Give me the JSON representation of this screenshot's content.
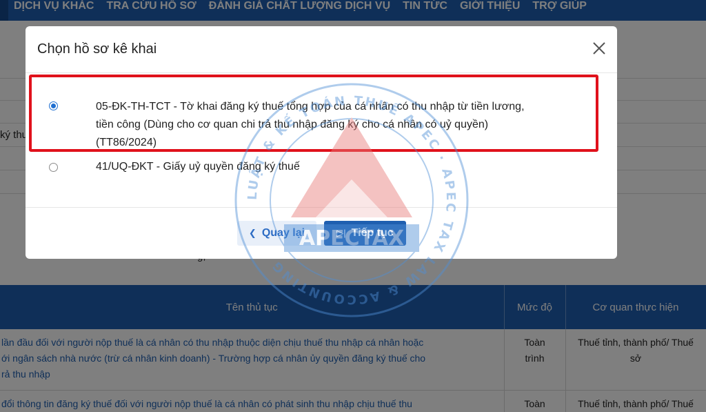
{
  "topnav": {
    "items": [
      "DỊCH VỤ KHÁC",
      "TRA CỨU HỒ SƠ",
      "ĐÁNH GIÁ CHẤT LƯỢNG DỊCH VỤ",
      "TIN TỨC",
      "GIỚI THIỆU",
      "TRỢ GIÚP"
    ]
  },
  "background": {
    "left_fragment": "ký thu",
    "mid_fragment": "g,"
  },
  "table": {
    "headers": [
      "Tên thủ tục",
      "Mức độ",
      "Cơ quan thực hiện"
    ],
    "rows": [
      {
        "name_lines": [
          "lần đầu đối với người nộp thuế là cá nhân có thu nhập thuộc diện chịu thuế thu nhập cá nhân hoặc",
          "ới ngân sách nhà nước (trừ cá nhân kinh doanh) - Trường hợp cá nhân ủy quyền đăng ký thuế cho",
          "rả thu nhập"
        ],
        "level_lines": [
          "Toàn",
          "trình"
        ],
        "agency_lines": [
          "Thuế tỉnh, thành phố/ Thuế",
          "sở"
        ]
      },
      {
        "name_lines": [
          "đổi thông tin đăng ký thuế đối với người nộp thuế là cá nhân có phát sinh thu nhập chịu thuế thu"
        ],
        "level_lines": [
          "Toàn"
        ],
        "agency_lines": [
          "Thuế tỉnh, thành phố/ Thuế"
        ]
      }
    ]
  },
  "modal": {
    "title": "Chọn hồ sơ kê khai",
    "options": [
      {
        "lines": [
          "05-ĐK-TH-TCT - Tờ khai đăng ký thuế tổng hợp của cá nhân có thu nhập từ tiền lương,",
          "tiền công (Dùng cho cơ quan chi trả thu nhập đăng ký cho cá nhân có uỷ quyền)",
          "(TT86/2024)"
        ],
        "selected": true
      },
      {
        "lines": [
          "41/UQ-ĐKT - Giấy uỷ quyền đăng ký thuế"
        ],
        "selected": false
      }
    ],
    "back_label": "Quay lại",
    "next_label": "Tiếp tục",
    "icons": {
      "close": "close-icon",
      "back": "chevron-left-icon",
      "next": "skip-next-icon"
    }
  },
  "watermark": {
    "brand": "APECTAX",
    "ring_text": "LUẬT & KẾ TOÁN THUẾ APEC · APEC TAX LAW & ACCOUNTING"
  },
  "colors": {
    "nav_blue": "#1f5fb0",
    "highlight_red": "#e0111b",
    "radio_blue": "#1f6fd1"
  }
}
